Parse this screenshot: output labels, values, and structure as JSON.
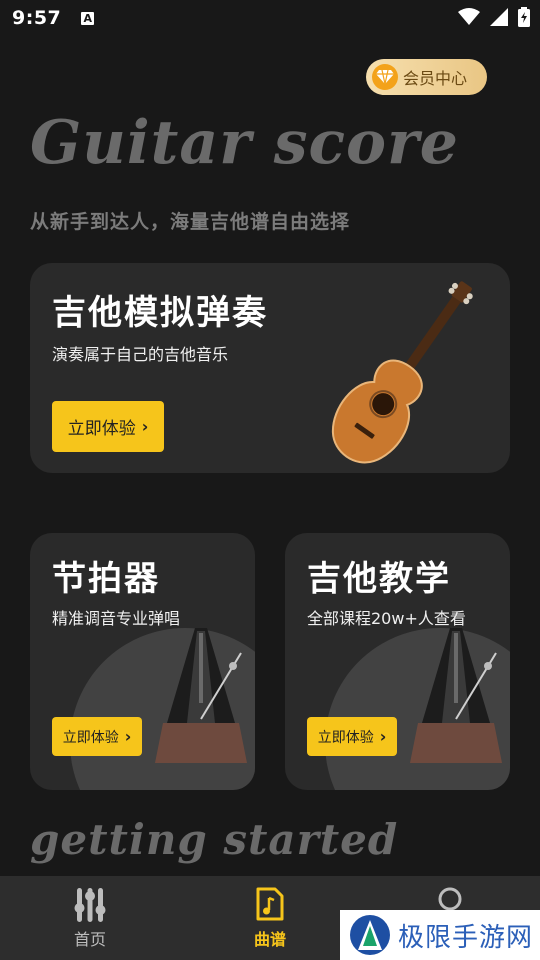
{
  "status_bar": {
    "time": "9:57",
    "notification_icon": "A"
  },
  "vip": {
    "label": "会员中心",
    "icon": "diamond-icon"
  },
  "hero": {
    "title": "Guitar score",
    "subtitle": "从新手到达人，海量吉他谱自由选择"
  },
  "cards": {
    "guitar_sim": {
      "title": "吉他模拟弹奏",
      "desc": "演奏属于自己的吉他音乐",
      "button": "立即体验",
      "image": "acoustic-guitar"
    },
    "metronome": {
      "title": "节拍器",
      "desc": "精准调音专业弹唱",
      "button": "立即体验",
      "image": "metronome"
    },
    "teaching": {
      "title": "吉他教学",
      "desc": "全部课程20w+人查看",
      "button": "立即体验",
      "image": "metronome"
    }
  },
  "section_heading": "getting started",
  "bottom_nav": {
    "items": [
      {
        "label": "首页",
        "icon": "sliders-icon",
        "active": false
      },
      {
        "label": "曲谱",
        "icon": "music-note-icon",
        "active": true
      },
      {
        "label": "",
        "icon": "profile-circle-icon",
        "active": false
      }
    ]
  },
  "watermark": {
    "text": "极限手游网"
  },
  "colors": {
    "background": "#181818",
    "card": "#2a2a2a",
    "accent": "#f6c51b",
    "vip_gold": "#e9c684"
  }
}
